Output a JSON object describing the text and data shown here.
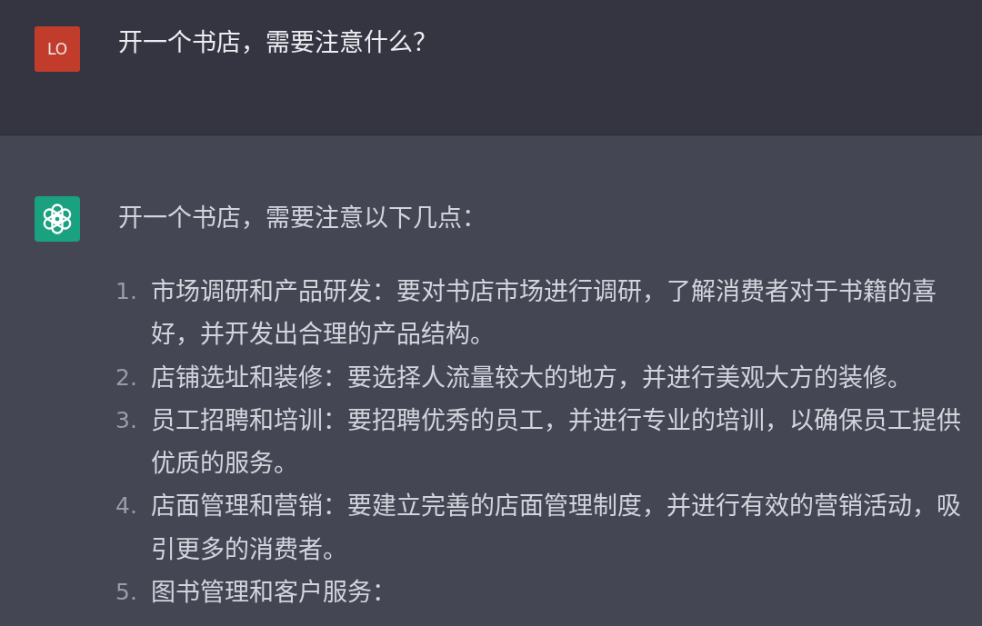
{
  "messages": [
    {
      "kind": "user",
      "avatar": {
        "initials": "LO"
      },
      "text": "开一个书店，需要注意什么？"
    },
    {
      "kind": "assistant",
      "text": "开一个书店，需要注意以下几点：",
      "list": [
        {
          "number": "1.",
          "text": "市场调研和产品研发：要对书店市场进行调研，了解消费者对于书籍的喜好，并开发出合理的产品结构。"
        },
        {
          "number": "2.",
          "text": "店铺选址和装修：要选择人流量较大的地方，并进行美观大方的装修。"
        },
        {
          "number": "3.",
          "text": "员工招聘和培训：要招聘优秀的员工，并进行专业的培训，以确保员工提供优质的服务。"
        },
        {
          "number": "4.",
          "text": "店面管理和营销：要建立完善的店面管理制度，并进行有效的营销活动，吸引更多的消费者。"
        },
        {
          "number": "5.",
          "text": "图书管理和客户服务："
        }
      ]
    }
  ]
}
